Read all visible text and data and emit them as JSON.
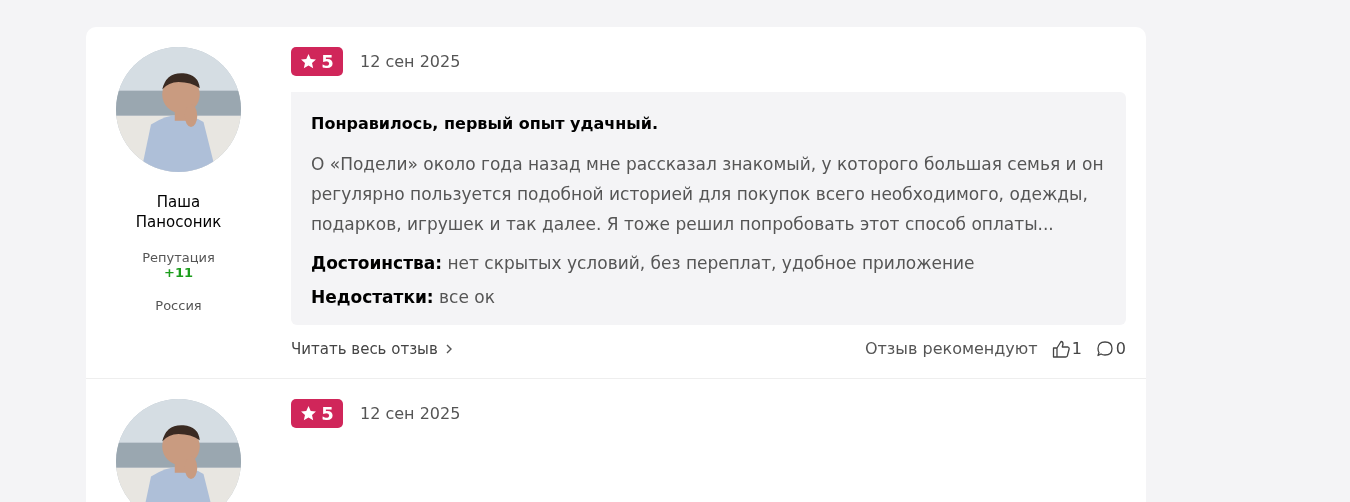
{
  "reviews": [
    {
      "author": {
        "name": "Паша Паносоник",
        "reputation_label": "Репутация",
        "reputation_value": "+11",
        "country": "Россия"
      },
      "rating": "5",
      "date": "12 сен 2025",
      "title": "Понравилось, первый опыт удачный.",
      "text": "О «Подели» около года назад мне рассказал знакомый, у которого большая семья и он регулярно пользуется подобной историей для покупок всего необходимого, одежды, подарков, игрушек и так далее. Я тоже решил попробовать этот способ оплаты...",
      "pros": {
        "label": "Достоинства:",
        "text": "нет скрытых условий, без переплат, удобное приложение"
      },
      "cons": {
        "label": "Недостатки:",
        "text": "все ок"
      },
      "read_more": "Читать весь отзыв",
      "recommend_label": "Отзыв рекомендуют",
      "likes": "1",
      "comments": "0"
    },
    {
      "rating": "5",
      "date": "12 сен 2025"
    }
  ]
}
